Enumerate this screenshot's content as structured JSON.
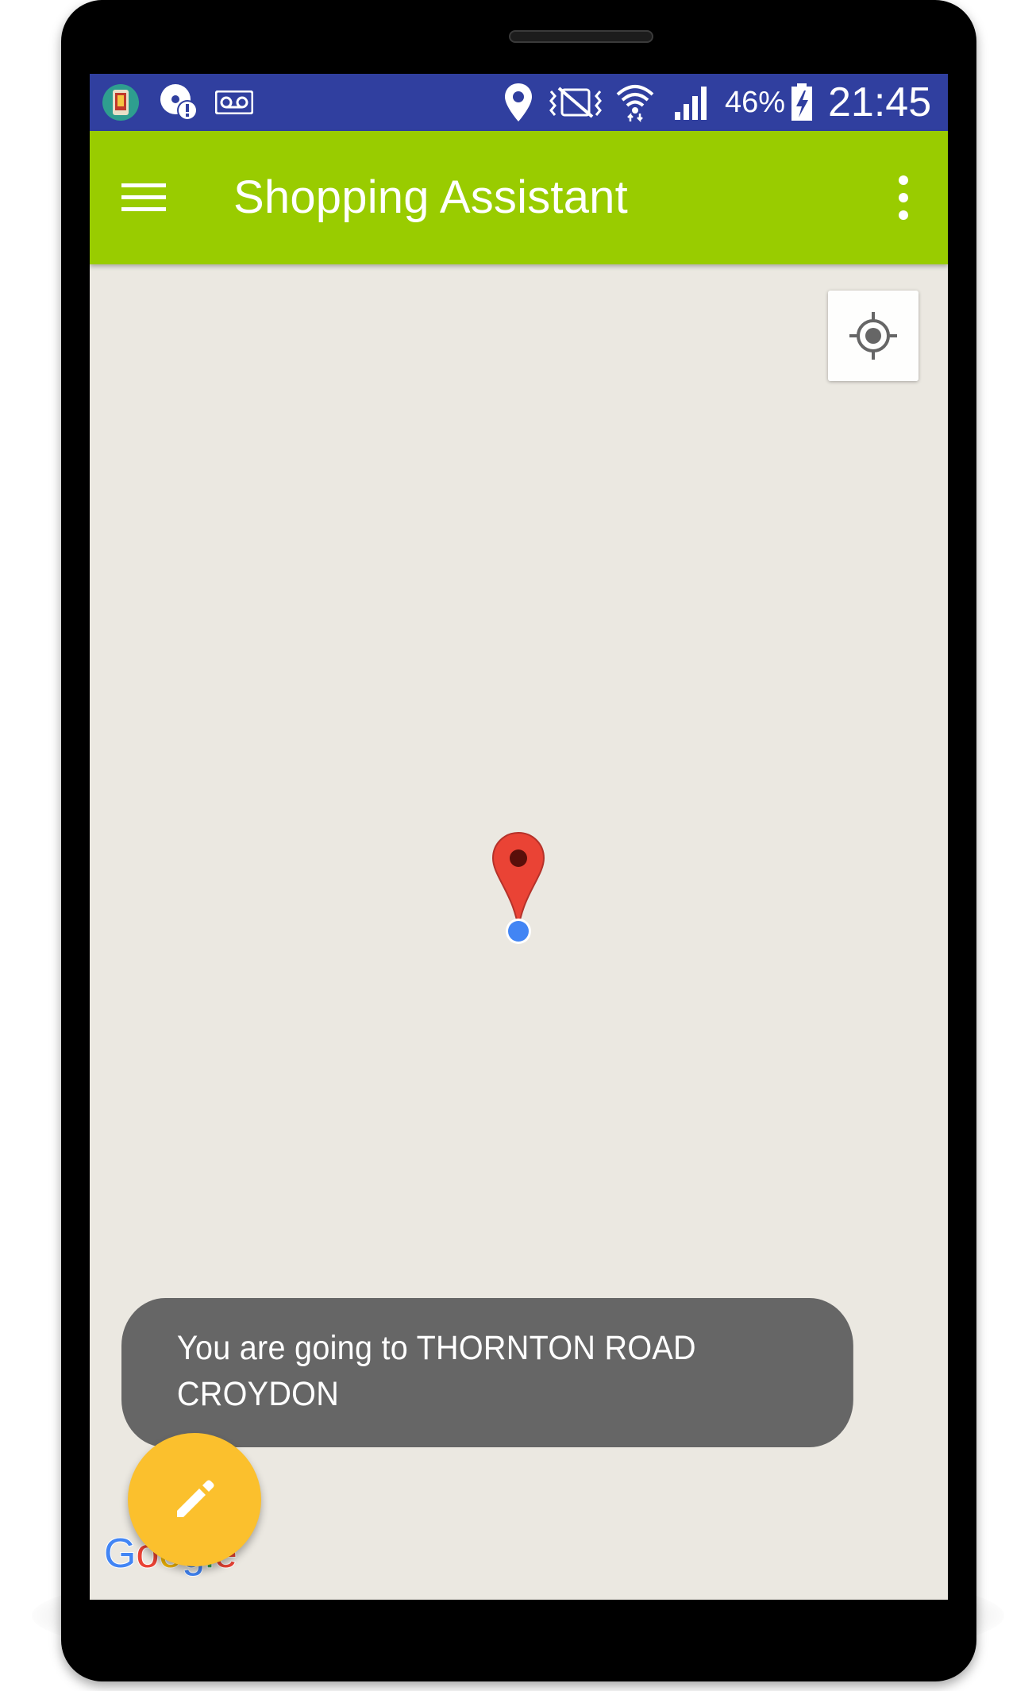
{
  "status_bar": {
    "battery_percent": "46%",
    "time": "21:45",
    "icons": [
      "app-notification-icon",
      "disc-alert-icon",
      "voicemail-icon",
      "location-icon",
      "vibrate-icon",
      "wifi-icon",
      "cell-signal-icon",
      "battery-charging-icon"
    ]
  },
  "app_bar": {
    "title": "Shopping Assistant",
    "menu_icon": "hamburger-menu-icon",
    "overflow_icon": "more-vert-icon"
  },
  "map": {
    "locate_icon": "my-location-icon",
    "marker_icon": "map-pin-icon",
    "google_logo": {
      "letters": [
        "G",
        "o",
        "o",
        "g",
        "l",
        "e"
      ],
      "colors": [
        "#4285f4",
        "#ea4335",
        "#fbbc05",
        "#4285f4",
        "#34a853",
        "#ea4335"
      ]
    }
  },
  "toast": {
    "message": "You are going to THORNTON ROAD CROYDON"
  },
  "fab": {
    "icon": "pencil-edit-icon"
  },
  "colors": {
    "status_bar": "#303f9f",
    "app_bar": "#99cc00",
    "map_background": "#ebe8e1",
    "toast": "#666666",
    "fab": "#fbc02d",
    "marker": "#ea4335",
    "blue_dot": "#4285f4"
  }
}
